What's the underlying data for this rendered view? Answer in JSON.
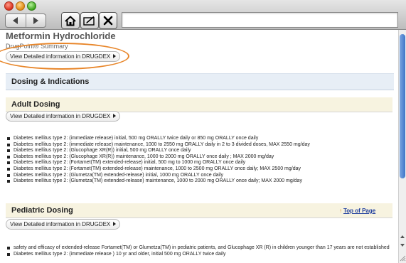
{
  "colors": {
    "accent_link": "#1a3a9c",
    "annotation_outline": "#e8862a",
    "section_bar": "#e7eef6",
    "subheading_bg": "#f7f3e0",
    "scroll_thumb": "#3f74c8"
  },
  "toolbar": {
    "back_icon": "back-arrow-icon",
    "forward_icon": "forward-arrow-icon",
    "home_icon": "home-icon",
    "edit_icon": "edit-note-icon",
    "close_icon": "close-x-icon",
    "address_value": ""
  },
  "header": {
    "title": "Metformin Hydrochloride",
    "subtitle": "DrugPoint® Summary",
    "detail_button": "View Detailed information in DRUGDEX"
  },
  "sections": {
    "dosing_title": "Dosing & Indications",
    "adult": {
      "title": "Adult Dosing",
      "detail_button": "View Detailed information in DRUGDEX",
      "items": [
        "Diabetes mellitus type 2: (immediate release) initial, 500 mg ORALLY twice daily or 850 mg ORALLY once daily",
        "Diabetes mellitus type 2: (immediate release) maintenance, 1000 to 2550 mg ORALLY daily in 2 to 3 divided doses, MAX 2550 mg/day",
        "Diabetes mellitus type 2: (Glucophage XR(R)) initial, 500 mg ORALLY once daily",
        "Diabetes mellitus type 2: (Glucophage XR(R)) maintenance, 1000 to 2000 mg ORALLY once daily ; MAX 2000 mg/day",
        "Diabetes mellitus type 2: (Fortamet(TM) extended-release) initial, 500 mg to 1000 mg ORALLY once daily",
        "Diabetes mellitus type 2: (Fortamet(TM) extended-release) maintenance, 1000 to 2500 mg ORALLY once daily; MAX 2500 mg/day",
        "Diabetes mellitus type 2: (Glumetza(TM) extended-release) initial, 1000 mg ORALLY once daily",
        "Diabetes mellitus type 2: (Glumetza(TM) extended-release) maintenance, 1000 to 2000 mg ORALLY once daily; MAX 2000 mg/day"
      ]
    },
    "pediatric": {
      "title": "Pediatric Dosing",
      "top_link": "Top of Page",
      "detail_button": "View Detailed information in DRUGDEX",
      "items": [
        "safety and efficacy of extended-release Fortamet(TM) or Glumetza(TM) in pediatric patients, and Glucophage XR (R) in children younger than 17 years are not established",
        "Diabetes mellitus type 2: (immediate release ) 10 yr and older, initial 500 mg ORALLY twice daily"
      ]
    }
  }
}
